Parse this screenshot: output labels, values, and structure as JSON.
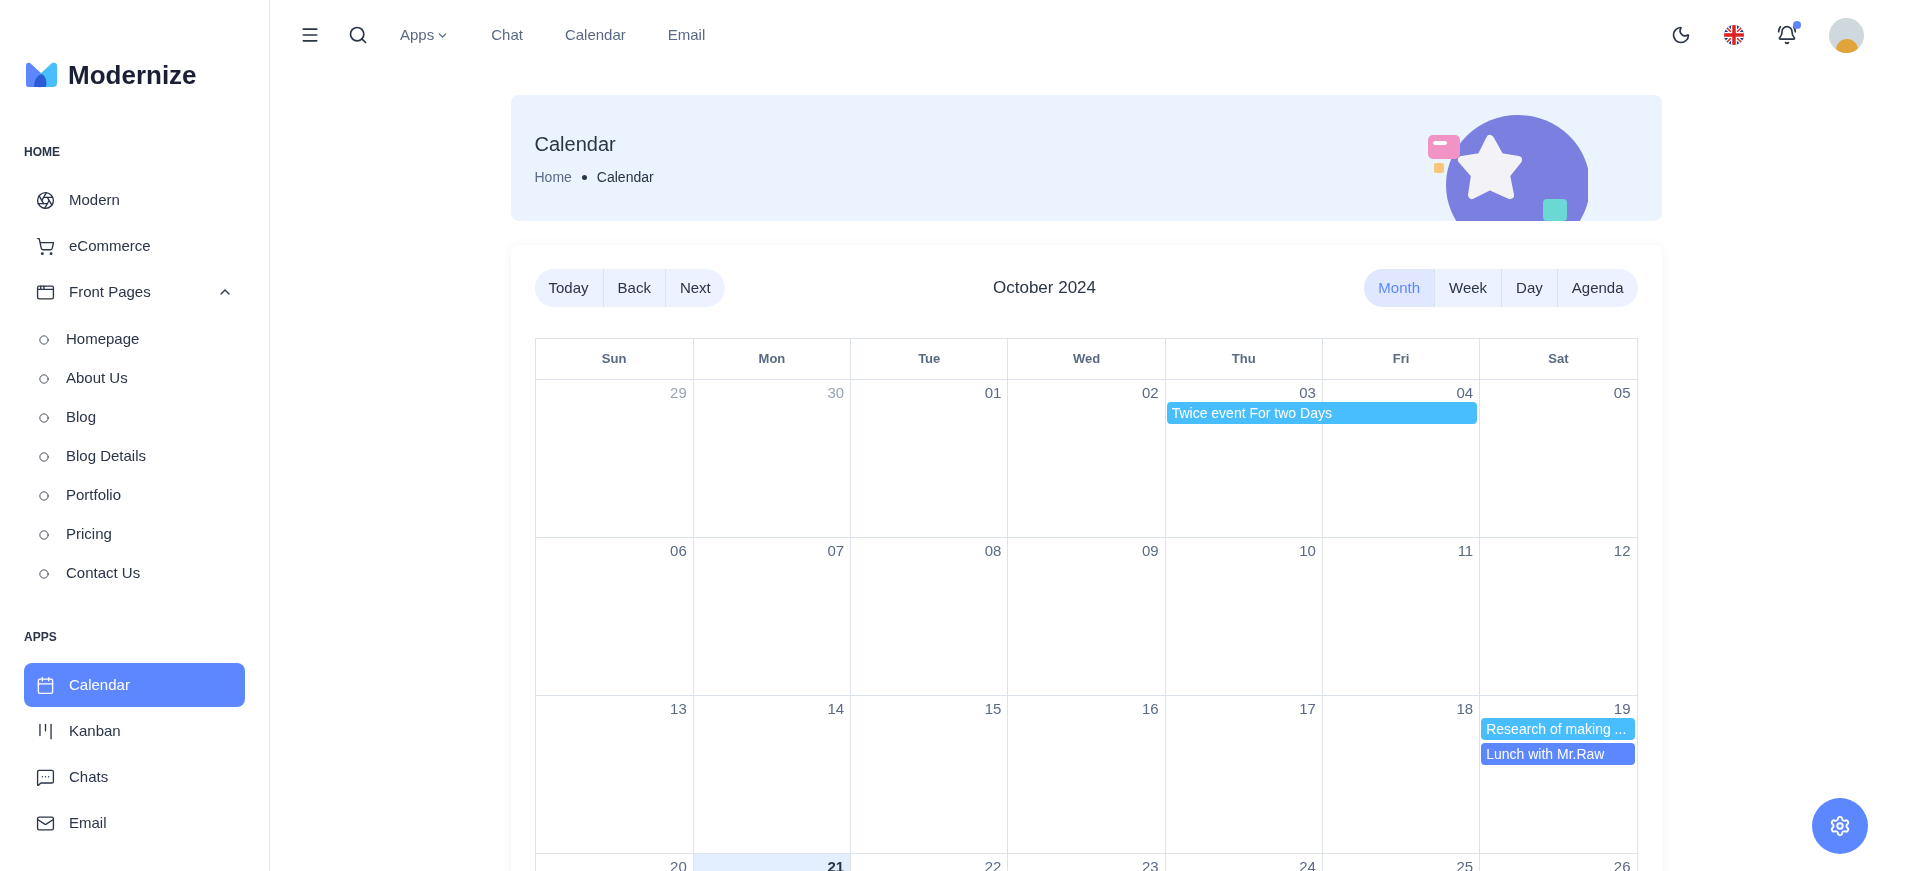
{
  "brand": {
    "name": "Modernize"
  },
  "sidebar": {
    "sections": [
      {
        "heading": "HOME",
        "items": [
          {
            "label": "Modern",
            "selected": false
          },
          {
            "label": "eCommerce",
            "selected": false
          },
          {
            "label": "Front Pages",
            "selected": false,
            "expanded": true,
            "children": [
              {
                "label": "Homepage"
              },
              {
                "label": "About Us"
              },
              {
                "label": "Blog"
              },
              {
                "label": "Blog Details"
              },
              {
                "label": "Portfolio"
              },
              {
                "label": "Pricing"
              },
              {
                "label": "Contact Us"
              }
            ]
          }
        ]
      },
      {
        "heading": "APPS",
        "items": [
          {
            "label": "Calendar",
            "selected": true
          },
          {
            "label": "Kanban",
            "selected": false
          },
          {
            "label": "Chats",
            "selected": false
          },
          {
            "label": "Email",
            "selected": false
          }
        ]
      }
    ]
  },
  "topbar": {
    "nav": [
      {
        "label": "Apps",
        "kind": "dropdown"
      },
      {
        "label": "Chat",
        "kind": "link"
      },
      {
        "label": "Calendar",
        "kind": "link"
      },
      {
        "label": "Email",
        "kind": "link"
      }
    ],
    "notification_dot": true
  },
  "header": {
    "title": "Calendar",
    "breadcrumb": [
      "Home",
      "Calendar"
    ]
  },
  "calendar": {
    "nav_buttons": [
      "Today",
      "Back",
      "Next"
    ],
    "title": "October 2024",
    "views": [
      {
        "label": "Month",
        "selected": true
      },
      {
        "label": "Week",
        "selected": false
      },
      {
        "label": "Day",
        "selected": false
      },
      {
        "label": "Agenda",
        "selected": false
      }
    ],
    "weekdays": [
      "Sun",
      "Mon",
      "Tue",
      "Wed",
      "Thu",
      "Fri",
      "Sat"
    ],
    "weeks": [
      {
        "days": [
          {
            "label": "29",
            "outside": true,
            "today": false
          },
          {
            "label": "30",
            "outside": true,
            "today": false
          },
          {
            "label": "01",
            "outside": false,
            "today": false
          },
          {
            "label": "02",
            "outside": false,
            "today": false
          },
          {
            "label": "03",
            "outside": false,
            "today": false,
            "events": [
              {
                "title": "Twice event For two Days",
                "color": "#49beff",
                "kind": "two-day"
              }
            ]
          },
          {
            "label": "04",
            "outside": false,
            "today": false
          },
          {
            "label": "05",
            "outside": false,
            "today": false
          }
        ]
      },
      {
        "days": [
          {
            "label": "06",
            "outside": false,
            "today": false
          },
          {
            "label": "07",
            "outside": false,
            "today": false
          },
          {
            "label": "08",
            "outside": false,
            "today": false
          },
          {
            "label": "09",
            "outside": false,
            "today": false
          },
          {
            "label": "10",
            "outside": false,
            "today": false
          },
          {
            "label": "11",
            "outside": false,
            "today": false
          },
          {
            "label": "12",
            "outside": false,
            "today": false
          }
        ]
      },
      {
        "days": [
          {
            "label": "13",
            "outside": false,
            "today": false
          },
          {
            "label": "14",
            "outside": false,
            "today": false
          },
          {
            "label": "15",
            "outside": false,
            "today": false
          },
          {
            "label": "16",
            "outside": false,
            "today": false
          },
          {
            "label": "17",
            "outside": false,
            "today": false
          },
          {
            "label": "18",
            "outside": false,
            "today": false
          },
          {
            "label": "19",
            "outside": false,
            "today": false,
            "events": [
              {
                "title": "Research of making ...",
                "color": "#49beff",
                "kind": "one-day"
              },
              {
                "title": "Lunch with Mr.Raw",
                "color": "#5d87ff",
                "kind": "one-day"
              }
            ]
          }
        ]
      },
      {
        "days": [
          {
            "label": "20",
            "outside": false,
            "today": false
          },
          {
            "label": "21",
            "outside": false,
            "today": true
          },
          {
            "label": "22",
            "outside": false,
            "today": false
          },
          {
            "label": "23",
            "outside": false,
            "today": false
          },
          {
            "label": "24",
            "outside": false,
            "today": false
          },
          {
            "label": "25",
            "outside": false,
            "today": false
          },
          {
            "label": "26",
            "outside": false,
            "today": false
          }
        ]
      }
    ]
  }
}
